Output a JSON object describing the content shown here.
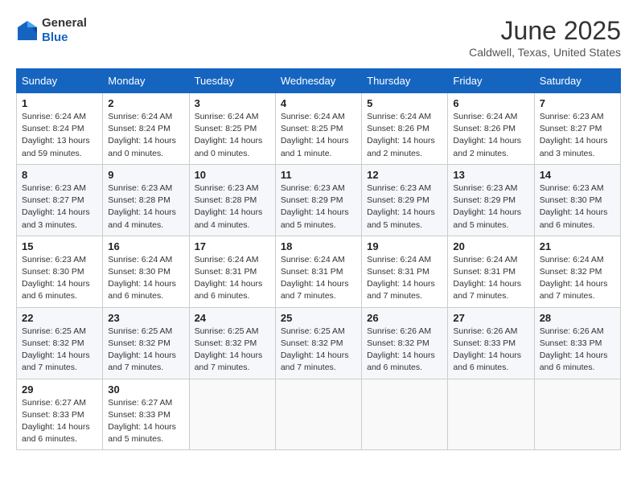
{
  "header": {
    "logo_line1": "General",
    "logo_line2": "Blue",
    "month": "June 2025",
    "location": "Caldwell, Texas, United States"
  },
  "days_of_week": [
    "Sunday",
    "Monday",
    "Tuesday",
    "Wednesday",
    "Thursday",
    "Friday",
    "Saturday"
  ],
  "weeks": [
    [
      {
        "day": "1",
        "lines": [
          "Sunrise: 6:24 AM",
          "Sunset: 8:24 PM",
          "Daylight: 13 hours",
          "and 59 minutes."
        ]
      },
      {
        "day": "2",
        "lines": [
          "Sunrise: 6:24 AM",
          "Sunset: 8:24 PM",
          "Daylight: 14 hours",
          "and 0 minutes."
        ]
      },
      {
        "day": "3",
        "lines": [
          "Sunrise: 6:24 AM",
          "Sunset: 8:25 PM",
          "Daylight: 14 hours",
          "and 0 minutes."
        ]
      },
      {
        "day": "4",
        "lines": [
          "Sunrise: 6:24 AM",
          "Sunset: 8:25 PM",
          "Daylight: 14 hours",
          "and 1 minute."
        ]
      },
      {
        "day": "5",
        "lines": [
          "Sunrise: 6:24 AM",
          "Sunset: 8:26 PM",
          "Daylight: 14 hours",
          "and 2 minutes."
        ]
      },
      {
        "day": "6",
        "lines": [
          "Sunrise: 6:24 AM",
          "Sunset: 8:26 PM",
          "Daylight: 14 hours",
          "and 2 minutes."
        ]
      },
      {
        "day": "7",
        "lines": [
          "Sunrise: 6:23 AM",
          "Sunset: 8:27 PM",
          "Daylight: 14 hours",
          "and 3 minutes."
        ]
      }
    ],
    [
      {
        "day": "8",
        "lines": [
          "Sunrise: 6:23 AM",
          "Sunset: 8:27 PM",
          "Daylight: 14 hours",
          "and 3 minutes."
        ]
      },
      {
        "day": "9",
        "lines": [
          "Sunrise: 6:23 AM",
          "Sunset: 8:28 PM",
          "Daylight: 14 hours",
          "and 4 minutes."
        ]
      },
      {
        "day": "10",
        "lines": [
          "Sunrise: 6:23 AM",
          "Sunset: 8:28 PM",
          "Daylight: 14 hours",
          "and 4 minutes."
        ]
      },
      {
        "day": "11",
        "lines": [
          "Sunrise: 6:23 AM",
          "Sunset: 8:29 PM",
          "Daylight: 14 hours",
          "and 5 minutes."
        ]
      },
      {
        "day": "12",
        "lines": [
          "Sunrise: 6:23 AM",
          "Sunset: 8:29 PM",
          "Daylight: 14 hours",
          "and 5 minutes."
        ]
      },
      {
        "day": "13",
        "lines": [
          "Sunrise: 6:23 AM",
          "Sunset: 8:29 PM",
          "Daylight: 14 hours",
          "and 5 minutes."
        ]
      },
      {
        "day": "14",
        "lines": [
          "Sunrise: 6:23 AM",
          "Sunset: 8:30 PM",
          "Daylight: 14 hours",
          "and 6 minutes."
        ]
      }
    ],
    [
      {
        "day": "15",
        "lines": [
          "Sunrise: 6:23 AM",
          "Sunset: 8:30 PM",
          "Daylight: 14 hours",
          "and 6 minutes."
        ]
      },
      {
        "day": "16",
        "lines": [
          "Sunrise: 6:24 AM",
          "Sunset: 8:30 PM",
          "Daylight: 14 hours",
          "and 6 minutes."
        ]
      },
      {
        "day": "17",
        "lines": [
          "Sunrise: 6:24 AM",
          "Sunset: 8:31 PM",
          "Daylight: 14 hours",
          "and 6 minutes."
        ]
      },
      {
        "day": "18",
        "lines": [
          "Sunrise: 6:24 AM",
          "Sunset: 8:31 PM",
          "Daylight: 14 hours",
          "and 7 minutes."
        ]
      },
      {
        "day": "19",
        "lines": [
          "Sunrise: 6:24 AM",
          "Sunset: 8:31 PM",
          "Daylight: 14 hours",
          "and 7 minutes."
        ]
      },
      {
        "day": "20",
        "lines": [
          "Sunrise: 6:24 AM",
          "Sunset: 8:31 PM",
          "Daylight: 14 hours",
          "and 7 minutes."
        ]
      },
      {
        "day": "21",
        "lines": [
          "Sunrise: 6:24 AM",
          "Sunset: 8:32 PM",
          "Daylight: 14 hours",
          "and 7 minutes."
        ]
      }
    ],
    [
      {
        "day": "22",
        "lines": [
          "Sunrise: 6:25 AM",
          "Sunset: 8:32 PM",
          "Daylight: 14 hours",
          "and 7 minutes."
        ]
      },
      {
        "day": "23",
        "lines": [
          "Sunrise: 6:25 AM",
          "Sunset: 8:32 PM",
          "Daylight: 14 hours",
          "and 7 minutes."
        ]
      },
      {
        "day": "24",
        "lines": [
          "Sunrise: 6:25 AM",
          "Sunset: 8:32 PM",
          "Daylight: 14 hours",
          "and 7 minutes."
        ]
      },
      {
        "day": "25",
        "lines": [
          "Sunrise: 6:25 AM",
          "Sunset: 8:32 PM",
          "Daylight: 14 hours",
          "and 7 minutes."
        ]
      },
      {
        "day": "26",
        "lines": [
          "Sunrise: 6:26 AM",
          "Sunset: 8:32 PM",
          "Daylight: 14 hours",
          "and 6 minutes."
        ]
      },
      {
        "day": "27",
        "lines": [
          "Sunrise: 6:26 AM",
          "Sunset: 8:33 PM",
          "Daylight: 14 hours",
          "and 6 minutes."
        ]
      },
      {
        "day": "28",
        "lines": [
          "Sunrise: 6:26 AM",
          "Sunset: 8:33 PM",
          "Daylight: 14 hours",
          "and 6 minutes."
        ]
      }
    ],
    [
      {
        "day": "29",
        "lines": [
          "Sunrise: 6:27 AM",
          "Sunset: 8:33 PM",
          "Daylight: 14 hours",
          "and 6 minutes."
        ]
      },
      {
        "day": "30",
        "lines": [
          "Sunrise: 6:27 AM",
          "Sunset: 8:33 PM",
          "Daylight: 14 hours",
          "and 5 minutes."
        ]
      },
      {
        "day": "",
        "lines": []
      },
      {
        "day": "",
        "lines": []
      },
      {
        "day": "",
        "lines": []
      },
      {
        "day": "",
        "lines": []
      },
      {
        "day": "",
        "lines": []
      }
    ]
  ]
}
